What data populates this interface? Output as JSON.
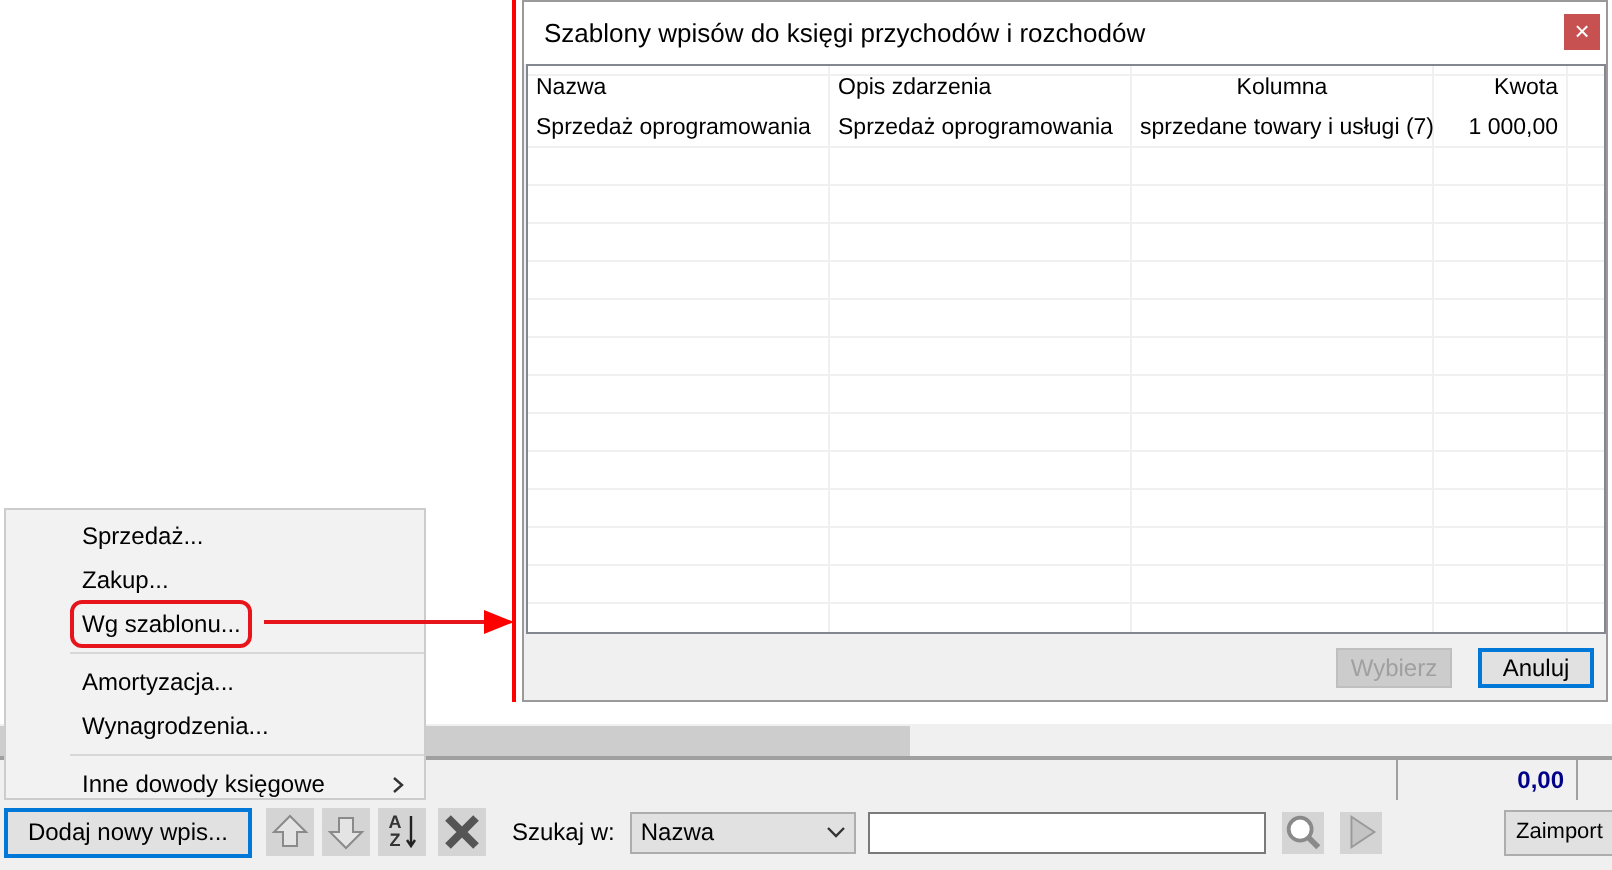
{
  "menu": {
    "items": [
      {
        "kind": "item",
        "label": "Sprzedaż...",
        "annotated": false
      },
      {
        "kind": "item",
        "label": "Zakup...",
        "annotated": false
      },
      {
        "kind": "item",
        "label": "Wg szablonu...",
        "annotated": true
      },
      {
        "kind": "separator"
      },
      {
        "kind": "item",
        "label": "Amortyzacja...",
        "annotated": false
      },
      {
        "kind": "item",
        "label": "Wynagrodzenia...",
        "annotated": false
      },
      {
        "kind": "separator"
      },
      {
        "kind": "submenu",
        "label": "Inne dowody księgowe",
        "annotated": false
      }
    ]
  },
  "dialog": {
    "title": "Szablony wpisów do księgi przychodów i rozchodów",
    "close": "×",
    "table": {
      "columns": [
        "Nazwa",
        "Opis zdarzenia",
        "Kolumna",
        "Kwota"
      ],
      "rows": [
        [
          "Sprzedaż oprogramowania",
          "Sprzedaż oprogramowania",
          "sprzedane towary i usługi (7)",
          "1 000,00"
        ]
      ]
    },
    "buttons": [
      {
        "label": "Wybierz",
        "disabled": true,
        "focused": false
      },
      {
        "label": "Anuluj",
        "disabled": false,
        "focused": true
      }
    ]
  },
  "summary": {
    "total": "0,00"
  },
  "toolbar": {
    "add_button": {
      "label": "Dodaj nowy wpis...",
      "focused": true
    },
    "tools": [
      {
        "kind": "up",
        "disabled": true
      },
      {
        "kind": "down",
        "disabled": true
      },
      {
        "kind": "sort",
        "disabled": false,
        "top": "A",
        "bottom": "Z"
      },
      {
        "kind": "delete",
        "disabled": false
      }
    ],
    "search_label": "Szukaj w:",
    "search_field": "Nazwa",
    "search_buttons": [
      {
        "kind": "search",
        "disabled": false
      },
      {
        "kind": "go",
        "disabled": true
      }
    ],
    "import_button": "Zaimport"
  }
}
